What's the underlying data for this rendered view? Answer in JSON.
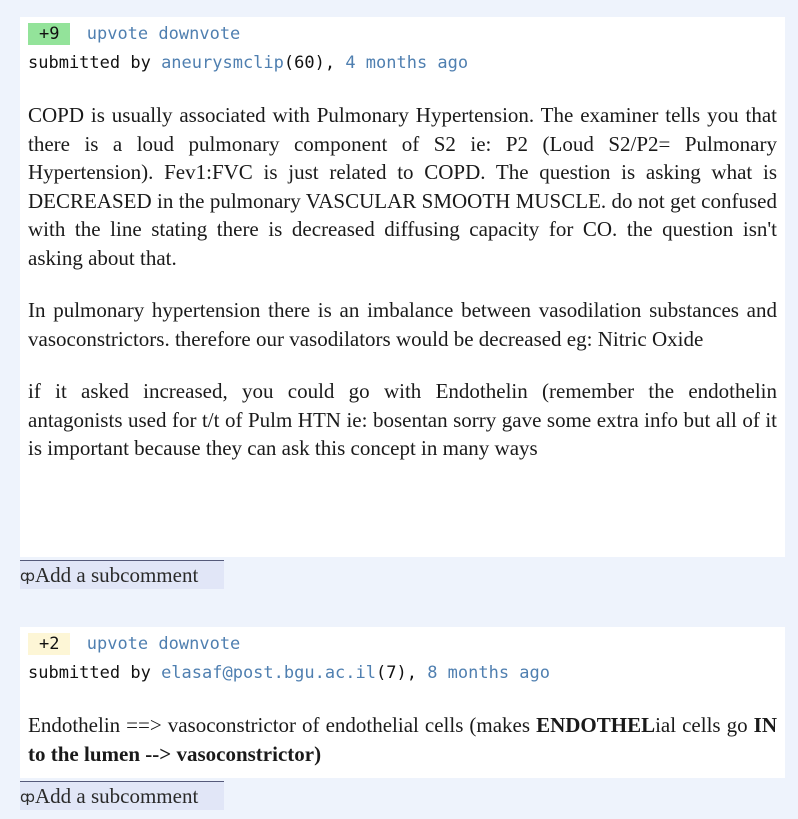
{
  "comments": [
    {
      "score": "+9",
      "upvote": "upvote",
      "downvote": "downvote",
      "submitted_by": "submitted by ",
      "user": "aneurysmclip",
      "user_karma": "(60), ",
      "age": "4 months ago",
      "paragraphs": [
        "COPD is usually associated with Pulmonary Hypertension. The examiner tells you that there is a loud pulmonary component of S2 ie: P2 (Loud S2/P2= Pulmonary Hypertension). Fev1:FVC is just related to COPD. The question is asking what is DECREASED in the pulmonary VASCULAR SMOOTH MUSCLE. do not get confused with the line stating there is decreased diffusing capacity for CO. the question isn't asking about that.",
        "In pulmonary hypertension there is an imbalance between vasodilation substances and vasoconstrictors. therefore our vasodilators would be decreased eg: Nitric Oxide",
        "if it asked increased, you could go with Endothelin (remember the endothelin antagonists used for t/t of Pulm HTN ie: bosentan sorry gave some extra info but all of it is important because they can ask this concept in many ways"
      ],
      "subcomment_icon": "ȹ",
      "subcomment_label": "Add a subcomment"
    },
    {
      "score": "+2",
      "upvote": "upvote",
      "downvote": "downvote",
      "submitted_by": "submitted by ",
      "user": "elasaf@post.bgu.ac.il",
      "user_karma": "(7), ",
      "age": "8 months ago",
      "rich_body": {
        "part1": "Endothelin ==> vasoconstrictor of endothelial cells (makes ",
        "bold1": "ENDOTHEL",
        "part2": "ial cells go ",
        "bold2": "IN to the lumen --> vasoconstrictor)"
      },
      "subcomment_icon": "ȹ",
      "subcomment_label": "Add a subcomment"
    }
  ]
}
